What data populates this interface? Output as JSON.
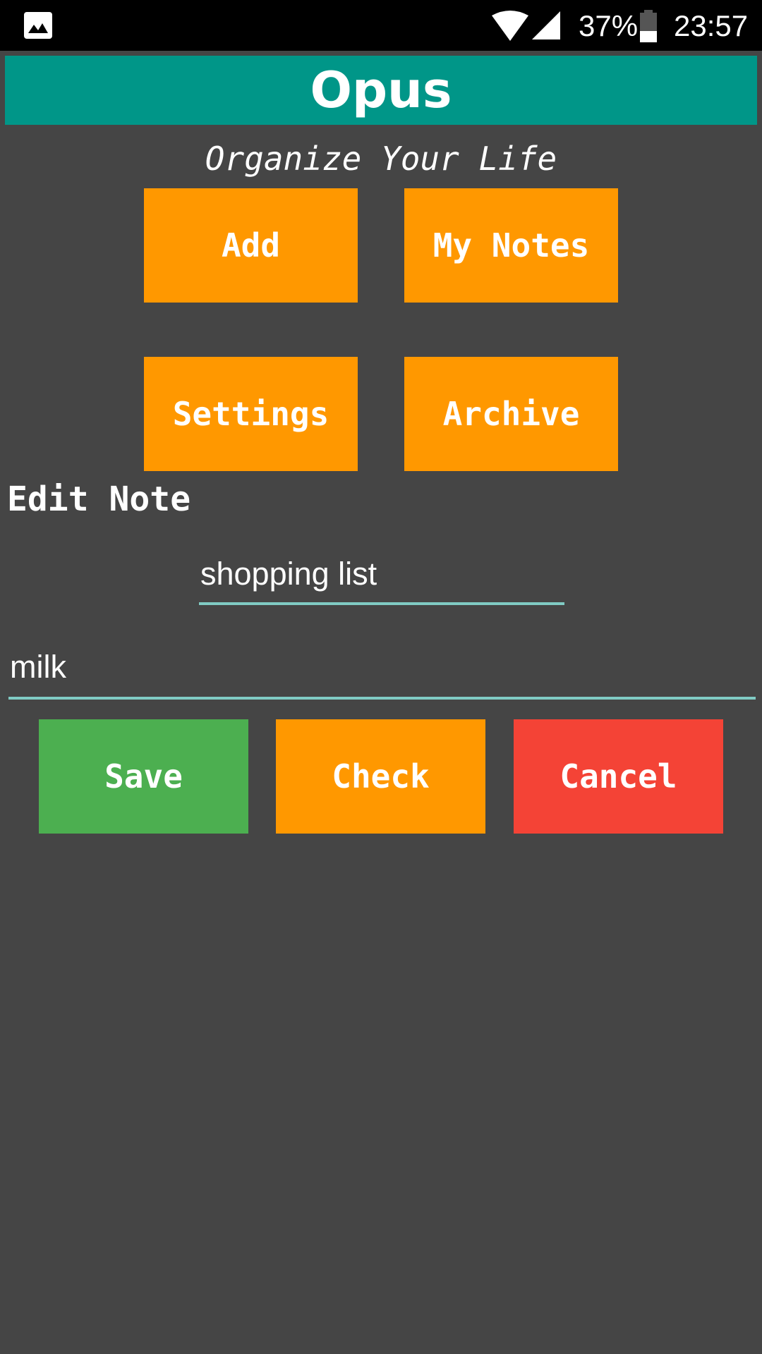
{
  "status_bar": {
    "battery": "37%",
    "time": "23:57",
    "icons": [
      "image-icon",
      "wifi-icon",
      "signal-icon",
      "battery-icon"
    ]
  },
  "app": {
    "title": "Opus",
    "subtitle": "Organize Your Life"
  },
  "nav": {
    "add": "Add",
    "my_notes": "My Notes",
    "settings": "Settings",
    "archive": "Archive"
  },
  "edit": {
    "heading": "Edit Note",
    "title_value": "shopping list",
    "body_value": "milk"
  },
  "actions": {
    "save": "Save",
    "check": "Check",
    "cancel": "Cancel"
  },
  "colors": {
    "appbar": "#009688",
    "orange": "#ff9800",
    "green": "#4caf50",
    "red": "#f44336",
    "background": "#454545",
    "underline": "#80cbc4"
  }
}
